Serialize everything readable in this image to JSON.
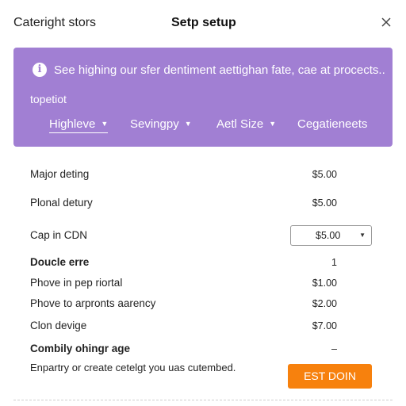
{
  "header": {
    "app_name": "Caterіght stors",
    "title": "Setp setup",
    "close_icon": "close-icon"
  },
  "banner": {
    "background": "#a17fd3",
    "icon": "info-icon",
    "icon_glyph": "i",
    "message": "See highing our sfer dentiment aettighan fate, cae at procects..",
    "subtext": "topetiot",
    "filters": [
      {
        "label": "Highleve",
        "active": true
      },
      {
        "label": "Sevingpy",
        "active": false
      },
      {
        "label": "Aetl Size",
        "active": false
      },
      {
        "label": "Cegatieneets",
        "active": false
      }
    ]
  },
  "rows": [
    {
      "label": "Major deting",
      "value": "$5.00"
    },
    {
      "label": "Plonal detury",
      "value": "$5.00"
    },
    {
      "label": "Cap in CDN",
      "value": "$5.00"
    },
    {
      "label": "Doucle erre",
      "value": "1"
    },
    {
      "label": "Phove in pep riortal",
      "value": "$1.00"
    },
    {
      "label": "Phove to arpronts aarency",
      "value": "$2.00"
    },
    {
      "label": "Clon devige",
      "value": "$7.00"
    },
    {
      "label": "Combily ohingr age",
      "value": "–"
    }
  ],
  "footer": {
    "text": "Enpartry or create cetelgt you uas cutembed.",
    "button_label": "EST DOIN",
    "button_color": "#f7810d"
  }
}
